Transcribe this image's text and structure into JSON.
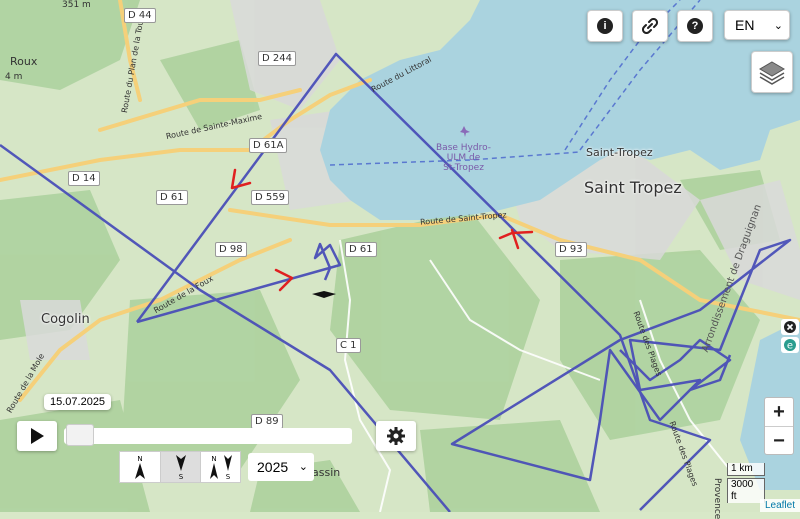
{
  "map": {
    "places": {
      "saint_tropez_big": "Saint Tropez",
      "saint_tropez_small": "Saint-Tropez",
      "cogolin": "Cogolin",
      "seaplane": "Base Hydro-\nULM de\nSt-Tropez",
      "roux": "Roux",
      "altitude_351": "351 m",
      "alt_4m": "4 m",
      "cassin": "assin",
      "arrondissement": "Arrondissement de Draguignan",
      "route_littoral": "Route du Littoral",
      "route_sainte_maxime": "Route de Sainte-Maxime",
      "route_plan_de_la_tour": "Route du Plan de la Tour",
      "route_saint_tropez": "Route de Saint-Tropez",
      "route_la_foux": "Route de la Foux",
      "route_la_mole": "Route de la Mole",
      "route_des_plages": "Route des Plages",
      "route_des_plages_2": "Route des Plages",
      "provence": "Provence"
    },
    "roads": [
      "D 44",
      "D 244",
      "D 61A",
      "D 14",
      "D 61",
      "D 559",
      "D 98",
      "D 61",
      "D 93",
      "C 1",
      "D 89"
    ],
    "colors": {
      "track": "#4a4fb8",
      "marker_red": "#e02020",
      "sea": "#aad3df",
      "land": "#d8e8c8"
    }
  },
  "toolbar": {
    "info_icon": "info-icon",
    "link_icon": "link-icon",
    "help_icon": "question-icon",
    "language": "EN",
    "layers_icon": "layers-icon"
  },
  "zoom": {
    "in": "+",
    "out": "−"
  },
  "scale": {
    "metric": "1 km",
    "imperial": "3000 ft"
  },
  "attribution": "Leaflet",
  "player": {
    "date": "15.07.2025",
    "progress": 0.0,
    "year": "2025",
    "orientation_labels": {
      "n1": "N",
      "s1": "S",
      "n2": "N",
      "s2": "S",
      "n3": "S"
    }
  }
}
